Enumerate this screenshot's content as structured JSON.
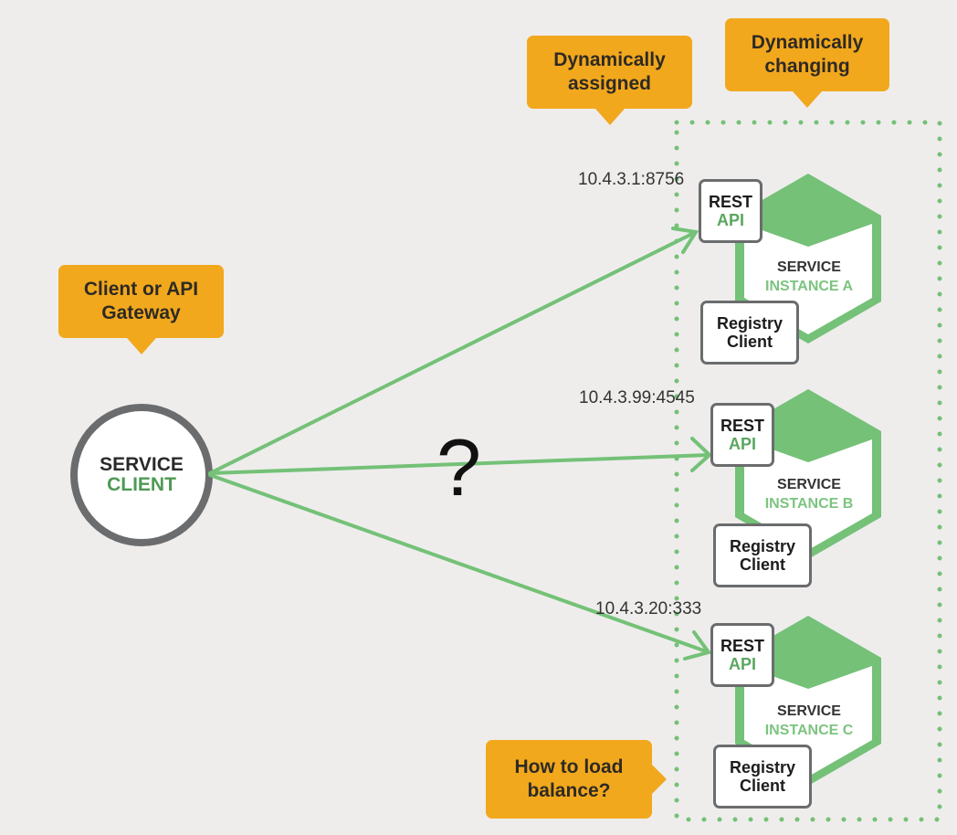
{
  "callouts": {
    "dynamically_assigned": [
      "Dynamically",
      "assigned"
    ],
    "dynamically_changing": [
      "Dynamically",
      "changing"
    ],
    "client_or_gateway": [
      "Client or API",
      "Gateway"
    ],
    "load_balance": [
      "How to load",
      "balance?"
    ]
  },
  "client": {
    "line1": "SERVICE",
    "line2": "CLIENT"
  },
  "question_mark": "?",
  "instances": [
    {
      "ip": "10.4.3.1:8756",
      "rest_line1": "REST",
      "rest_line2": "API",
      "service_line1": "SERVICE",
      "service_line2": "INSTANCE A",
      "registry_line1": "Registry",
      "registry_line2": "Client"
    },
    {
      "ip": "10.4.3.99:4545",
      "rest_line1": "REST",
      "rest_line2": "API",
      "service_line1": "SERVICE",
      "service_line2": "INSTANCE B",
      "registry_line1": "Registry",
      "registry_line2": "Client"
    },
    {
      "ip": "10.4.3.20:333",
      "rest_line1": "REST",
      "rest_line2": "API",
      "service_line1": "SERVICE",
      "service_line2": "INSTANCE C",
      "registry_line1": "Registry",
      "registry_line2": "Client"
    }
  ],
  "colors": {
    "background": "#eeedec",
    "callout": "#f2a81d",
    "accent_green": "#74c177",
    "border_gray": "#6b6c6e"
  }
}
